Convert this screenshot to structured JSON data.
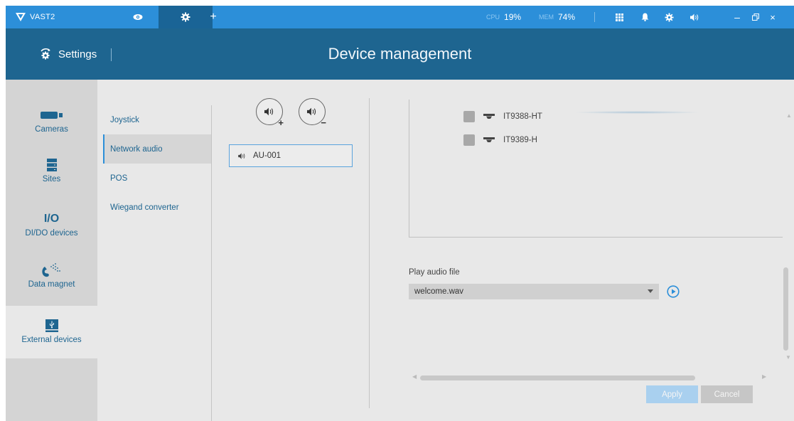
{
  "app": {
    "name": "VAST2"
  },
  "topbar": {
    "add_tab_label": "+",
    "cpu_label": "CPU",
    "cpu_value": "19%",
    "mem_label": "MEM",
    "mem_value": "74%",
    "min_label": "–",
    "close_label": "×"
  },
  "header": {
    "settings_label": "Settings",
    "title": "Device management"
  },
  "left_nav": [
    {
      "label": "Cameras",
      "icon": "camera-icon"
    },
    {
      "label": "Sites",
      "icon": "server-icon"
    },
    {
      "label": "I/O",
      "icon": "io-icon"
    },
    {
      "label": "DI/DO devices"
    },
    {
      "label": "Data magnet",
      "icon": "magnet-icon"
    },
    {
      "label": "External devices",
      "icon": "usb-device-icon",
      "active": true
    }
  ],
  "sub_nav": [
    {
      "label": "Joystick"
    },
    {
      "label": "Network audio",
      "active": true
    },
    {
      "label": "POS"
    },
    {
      "label": "Wiegand converter"
    }
  ],
  "audio_devices": [
    {
      "label": "AU-001",
      "selected": true
    }
  ],
  "device_list": [
    {
      "label": "IT9388-HT",
      "checked": false
    },
    {
      "label": "IT9389-H",
      "checked": false
    }
  ],
  "play_audio": {
    "label": "Play audio file",
    "selected": "welcome.wav"
  },
  "buttons": {
    "apply": "Apply",
    "cancel": "Cancel"
  },
  "colors": {
    "topbar": "#2c8fd9",
    "header": "#1e6590",
    "accent": "#1e6590"
  }
}
